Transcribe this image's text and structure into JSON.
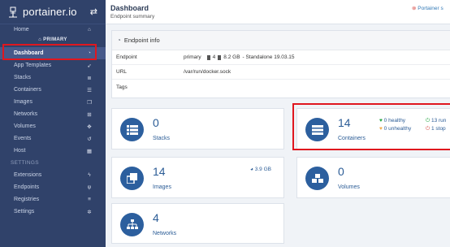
{
  "brand": {
    "name": "portainer.io"
  },
  "sidebar": {
    "endpoint": "PRIMARY",
    "items": [
      {
        "label": "Home",
        "icon": "home-icon",
        "glyph": "⌂"
      },
      {
        "label": "Dashboard",
        "icon": "tachometer-icon",
        "glyph": "◔",
        "active": true
      },
      {
        "label": "App Templates",
        "icon": "rocket-icon",
        "glyph": "➶"
      },
      {
        "label": "Stacks",
        "icon": "th-list-icon",
        "glyph": "≣"
      },
      {
        "label": "Containers",
        "icon": "server-icon",
        "glyph": "☰"
      },
      {
        "label": "Images",
        "icon": "clone-icon",
        "glyph": "❐"
      },
      {
        "label": "Networks",
        "icon": "sitemap-icon",
        "glyph": "⊞"
      },
      {
        "label": "Volumes",
        "icon": "cubes-icon",
        "glyph": "✥"
      },
      {
        "label": "Events",
        "icon": "history-icon",
        "glyph": "↺"
      },
      {
        "label": "Host",
        "icon": "th-icon",
        "glyph": "▦"
      }
    ],
    "settings_header": "SETTINGS",
    "settings_items": [
      {
        "label": "Extensions",
        "icon": "bolt-icon",
        "glyph": "ϟ"
      },
      {
        "label": "Endpoints",
        "icon": "plug-icon",
        "glyph": "ψ"
      },
      {
        "label": "Registries",
        "icon": "database-icon",
        "glyph": "≡"
      },
      {
        "label": "Settings",
        "icon": "cogs-icon",
        "glyph": "✲"
      }
    ]
  },
  "header": {
    "title": "Dashboard",
    "subtitle": "Endpoint summary",
    "right_link": "Portainer s"
  },
  "endpoint_info": {
    "title": "Endpoint info",
    "rows": {
      "endpoint_label": "Endpoint",
      "endpoint_name": "primary",
      "cpu": "4",
      "memory": "8.2 GB",
      "details": "- Standalone 19.03.15",
      "url_label": "URL",
      "url_value": "/var/run/docker.sock",
      "tags_label": "Tags"
    }
  },
  "widgets": {
    "stacks": {
      "value": "0",
      "label": "Stacks"
    },
    "containers": {
      "value": "14",
      "label": "Containers",
      "healthy": "0 healthy",
      "unhealthy": "0 unhealthy",
      "running": "13 run",
      "stopped": "1 stop"
    },
    "images": {
      "value": "14",
      "label": "Images",
      "size": "3.9 GB"
    },
    "volumes": {
      "value": "0",
      "label": "Volumes"
    },
    "networks": {
      "value": "4",
      "label": "Networks"
    }
  },
  "colors": {
    "sidebar": "#30426a",
    "accent": "#2c5f9e",
    "highlight": "#e0171f",
    "healthy": "#28a745",
    "unhealthy": "#f0ad4e",
    "stopped": "#d9534f"
  }
}
